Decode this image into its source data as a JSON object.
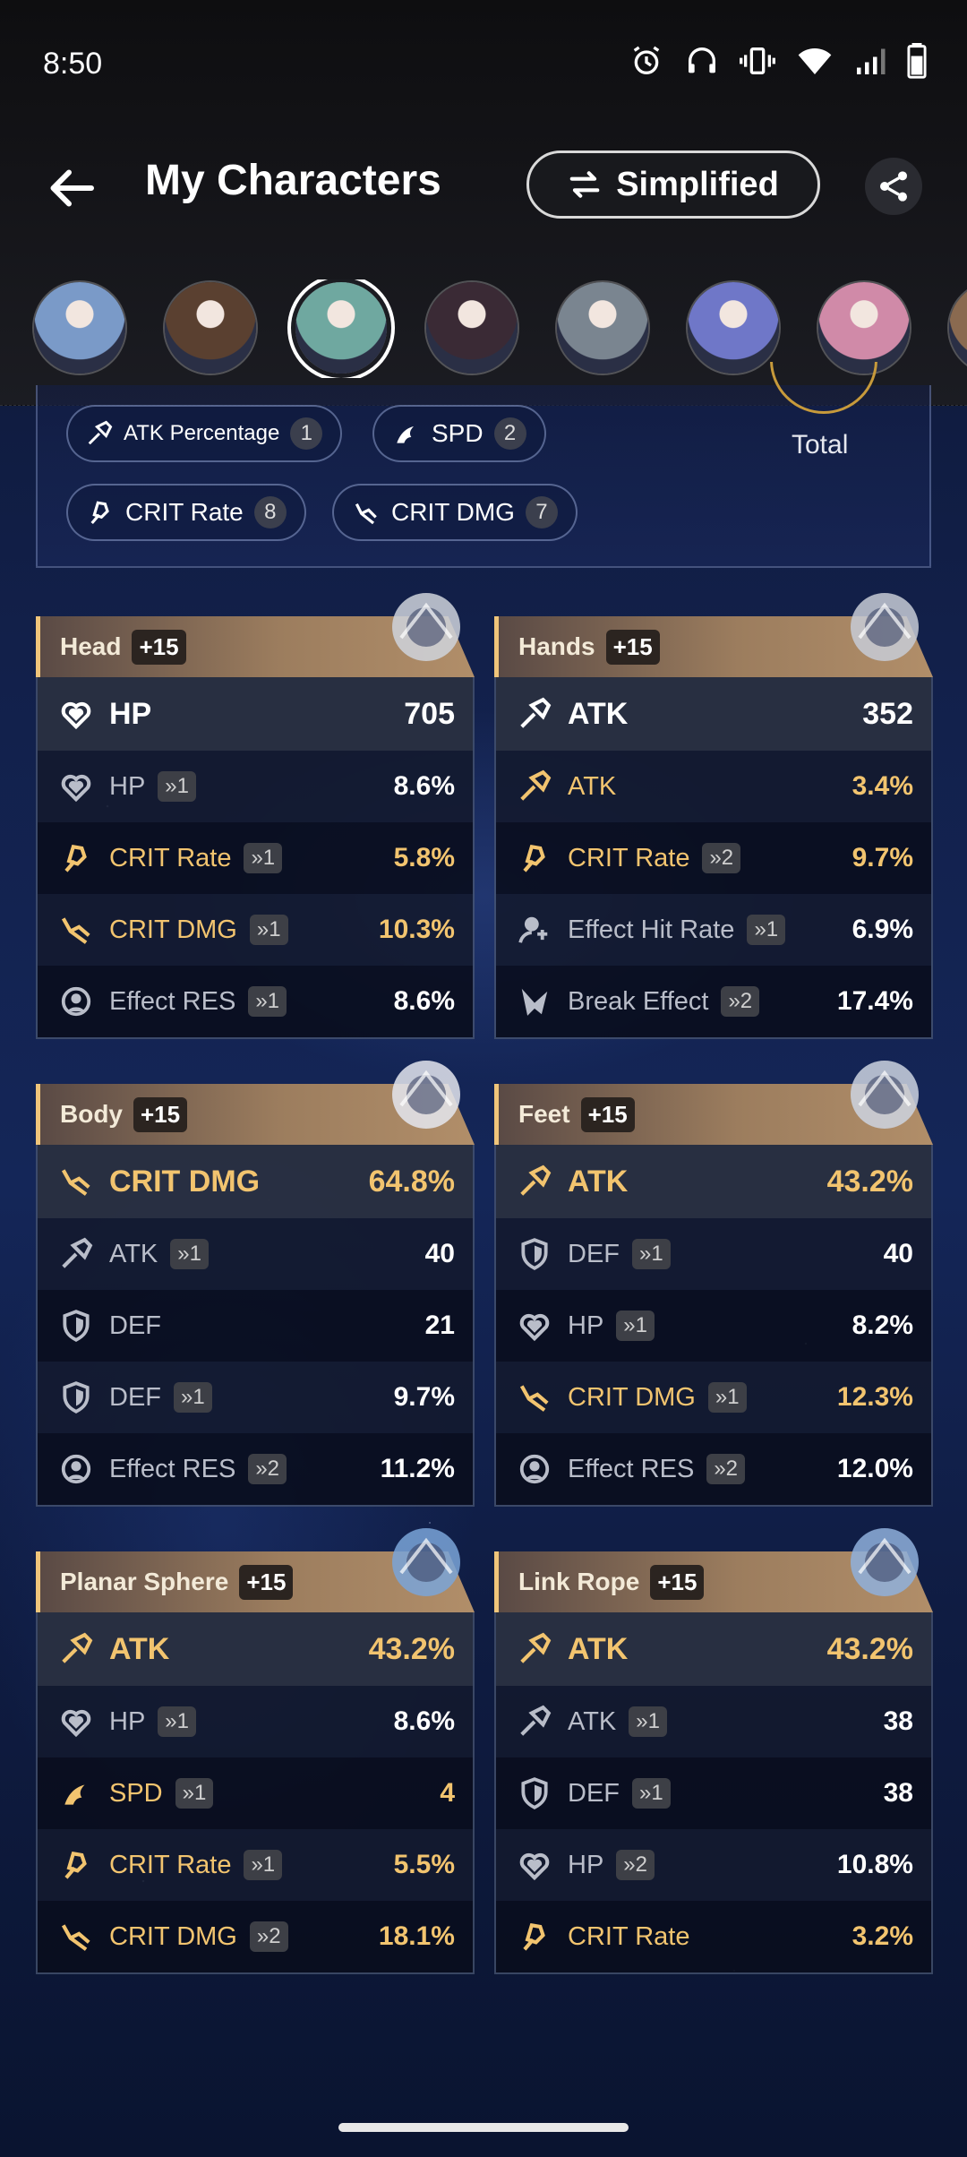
{
  "status_bar": {
    "time": "8:50"
  },
  "header": {
    "title": "My Characters",
    "mode_button": "Simplified"
  },
  "avatars": [
    {
      "name": "avatar-1",
      "color": "#7a9ac8"
    },
    {
      "name": "avatar-2",
      "color": "#5a4030"
    },
    {
      "name": "avatar-3",
      "color": "#6fa8a0",
      "selected": true
    },
    {
      "name": "avatar-4",
      "color": "#3a2a35"
    },
    {
      "name": "avatar-5",
      "color": "#7a8590"
    },
    {
      "name": "avatar-6",
      "color": "#6f77c8"
    },
    {
      "name": "avatar-7",
      "color": "#d08aa8"
    },
    {
      "name": "avatar-8",
      "color": "#8a6a50"
    }
  ],
  "summary": {
    "chips": [
      {
        "label": "ATK Percentage",
        "count": "1"
      },
      {
        "label": "SPD",
        "count": "2"
      },
      {
        "label": "CRIT Rate",
        "count": "8"
      },
      {
        "label": "CRIT DMG",
        "count": "7"
      }
    ],
    "total_label": "Total"
  },
  "relics": [
    {
      "slot": "Head",
      "level": "+15",
      "main": {
        "stat": "HP",
        "value": "705",
        "icon": "hp-icon",
        "gold": false
      },
      "subs": [
        {
          "stat": "HP",
          "roll": "»1",
          "value": "8.6%",
          "icon": "hp-icon",
          "gold": false
        },
        {
          "stat": "CRIT Rate",
          "roll": "»1",
          "value": "5.8%",
          "icon": "crit-rate-icon",
          "gold": true
        },
        {
          "stat": "CRIT DMG",
          "roll": "»1",
          "value": "10.3%",
          "icon": "crit-dmg-icon",
          "gold": true
        },
        {
          "stat": "Effect RES",
          "roll": "»1",
          "value": "8.6%",
          "icon": "effect-res-icon",
          "gold": false
        }
      ]
    },
    {
      "slot": "Hands",
      "level": "+15",
      "main": {
        "stat": "ATK",
        "value": "352",
        "icon": "atk-icon",
        "gold": false
      },
      "subs": [
        {
          "stat": "ATK",
          "roll": "",
          "value": "3.4%",
          "icon": "atk-icon",
          "gold": true
        },
        {
          "stat": "CRIT Rate",
          "roll": "»2",
          "value": "9.7%",
          "icon": "crit-rate-icon",
          "gold": true
        },
        {
          "stat": "Effect Hit Rate",
          "roll": "»1",
          "value": "6.9%",
          "icon": "effect-hit-icon",
          "gold": false
        },
        {
          "stat": "Break Effect",
          "roll": "»2",
          "value": "17.4%",
          "icon": "break-effect-icon",
          "gold": false
        }
      ]
    },
    {
      "slot": "Body",
      "level": "+15",
      "main": {
        "stat": "CRIT DMG",
        "value": "64.8%",
        "icon": "crit-dmg-icon",
        "gold": true
      },
      "subs": [
        {
          "stat": "ATK",
          "roll": "»1",
          "value": "40",
          "icon": "atk-icon",
          "gold": false
        },
        {
          "stat": "DEF",
          "roll": "",
          "value": "21",
          "icon": "def-icon",
          "gold": false
        },
        {
          "stat": "DEF",
          "roll": "»1",
          "value": "9.7%",
          "icon": "def-icon",
          "gold": false
        },
        {
          "stat": "Effect RES",
          "roll": "»2",
          "value": "11.2%",
          "icon": "effect-res-icon",
          "gold": false
        }
      ]
    },
    {
      "slot": "Feet",
      "level": "+15",
      "main": {
        "stat": "ATK",
        "value": "43.2%",
        "icon": "atk-icon",
        "gold": true
      },
      "subs": [
        {
          "stat": "DEF",
          "roll": "»1",
          "value": "40",
          "icon": "def-icon",
          "gold": false
        },
        {
          "stat": "HP",
          "roll": "»1",
          "value": "8.2%",
          "icon": "hp-icon",
          "gold": false
        },
        {
          "stat": "CRIT DMG",
          "roll": "»1",
          "value": "12.3%",
          "icon": "crit-dmg-icon",
          "gold": true
        },
        {
          "stat": "Effect RES",
          "roll": "»2",
          "value": "12.0%",
          "icon": "effect-res-icon",
          "gold": false
        }
      ]
    },
    {
      "slot": "Planar Sphere",
      "level": "+15",
      "main": {
        "stat": "ATK",
        "value": "43.2%",
        "icon": "atk-icon",
        "gold": true
      },
      "subs": [
        {
          "stat": "HP",
          "roll": "»1",
          "value": "8.6%",
          "icon": "hp-icon",
          "gold": false
        },
        {
          "stat": "SPD",
          "roll": "»1",
          "value": "4",
          "icon": "spd-icon",
          "gold": true
        },
        {
          "stat": "CRIT Rate",
          "roll": "»1",
          "value": "5.5%",
          "icon": "crit-rate-icon",
          "gold": true
        },
        {
          "stat": "CRIT DMG",
          "roll": "»2",
          "value": "18.1%",
          "icon": "crit-dmg-icon",
          "gold": true
        }
      ]
    },
    {
      "slot": "Link Rope",
      "level": "+15",
      "main": {
        "stat": "ATK",
        "value": "43.2%",
        "icon": "atk-icon",
        "gold": true
      },
      "subs": [
        {
          "stat": "ATK",
          "roll": "»1",
          "value": "38",
          "icon": "atk-icon",
          "gold": false
        },
        {
          "stat": "DEF",
          "roll": "»1",
          "value": "38",
          "icon": "def-icon",
          "gold": false
        },
        {
          "stat": "HP",
          "roll": "»2",
          "value": "10.8%",
          "icon": "hp-icon",
          "gold": false
        },
        {
          "stat": "CRIT Rate",
          "roll": "",
          "value": "3.2%",
          "icon": "crit-rate-icon",
          "gold": true
        }
      ]
    }
  ],
  "colors": {
    "gold": "#f2c46f",
    "accent_border": "#f0c57a"
  }
}
